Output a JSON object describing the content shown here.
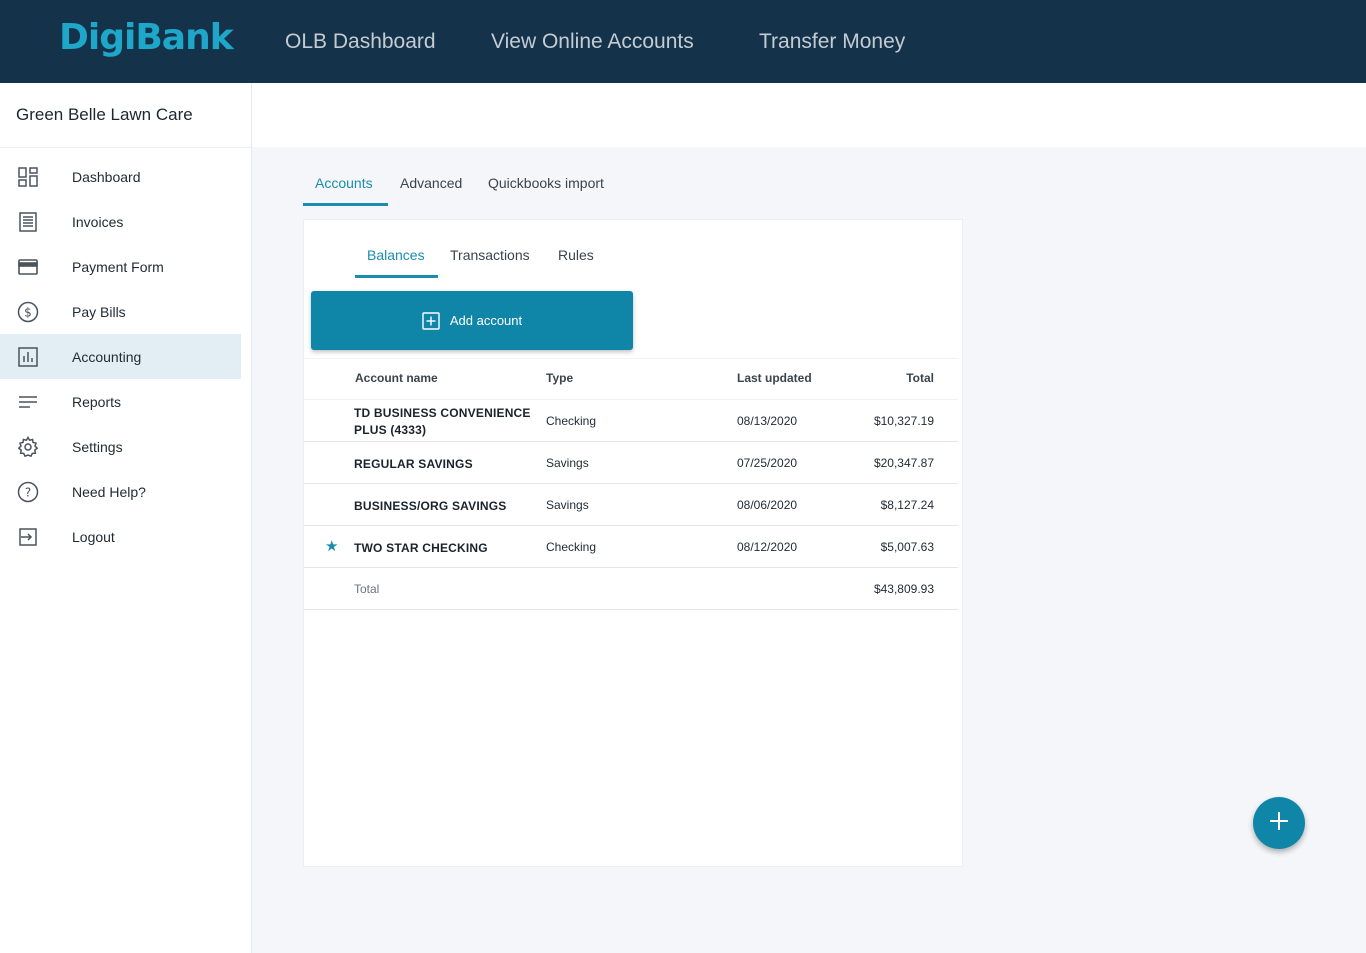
{
  "brand": {
    "logo": "DigiBank",
    "accent": "#1a8db0"
  },
  "topnav": [
    {
      "label": "OLB Dashboard"
    },
    {
      "label": "View Online Accounts"
    },
    {
      "label": "Transfer Money"
    }
  ],
  "sidebar": {
    "org_name": "Green Belle Lawn Care",
    "items": [
      {
        "label": "Dashboard",
        "icon": "dashboard-icon"
      },
      {
        "label": "Invoices",
        "icon": "invoice-icon"
      },
      {
        "label": "Payment Form",
        "icon": "credit-card-icon"
      },
      {
        "label": "Pay Bills",
        "icon": "dollar-circle-icon"
      },
      {
        "label": "Accounting",
        "icon": "chart-icon",
        "active": true
      },
      {
        "label": "Reports",
        "icon": "lines-icon"
      },
      {
        "label": "Settings",
        "icon": "gear-icon"
      },
      {
        "label": "Need Help?",
        "icon": "help-circle-icon"
      },
      {
        "label": "Logout",
        "icon": "logout-icon"
      }
    ]
  },
  "main_tabs": [
    {
      "label": "Accounts",
      "active": true
    },
    {
      "label": "Advanced"
    },
    {
      "label": "Quickbooks import"
    }
  ],
  "sub_tabs": [
    {
      "label": "Balances",
      "active": true
    },
    {
      "label": "Transactions"
    },
    {
      "label": "Rules"
    }
  ],
  "add_account_label": "Add account",
  "table": {
    "headers": {
      "name": "Account name",
      "type": "Type",
      "updated": "Last updated",
      "total": "Total"
    },
    "rows": [
      {
        "name_line1": "TD BUSINESS CONVENIENCE",
        "name_line2": "PLUS (4333)",
        "type": "Checking",
        "updated": "08/13/2020",
        "total": "$10,327.19",
        "starred": false
      },
      {
        "name_line1": "REGULAR SAVINGS",
        "name_line2": "",
        "type": "Savings",
        "updated": "07/25/2020",
        "total": "$20,347.87",
        "starred": false
      },
      {
        "name_line1": "BUSINESS/ORG SAVINGS",
        "name_line2": "",
        "type": "Savings",
        "updated": "08/06/2020",
        "total": "$8,127.24",
        "starred": false
      },
      {
        "name_line1": "TWO STAR CHECKING",
        "name_line2": "",
        "type": "Checking",
        "updated": "08/12/2020",
        "total": "$5,007.63",
        "starred": true
      }
    ],
    "footer": {
      "label": "Total",
      "total": "$43,809.93"
    }
  }
}
